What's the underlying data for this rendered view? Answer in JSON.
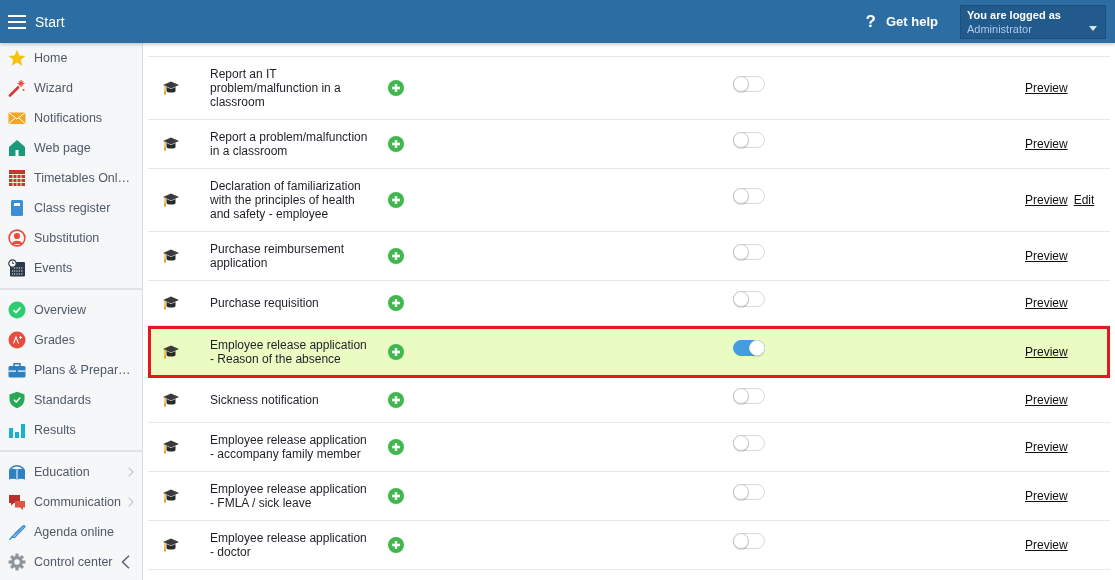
{
  "header": {
    "title": "Start",
    "help_icon": "?",
    "help_label": "Get help",
    "user": {
      "caption": "You are logged as",
      "name": "Administrator"
    }
  },
  "sidebar": {
    "groups": [
      {
        "items": [
          {
            "label": "Home",
            "submenu": false
          },
          {
            "label": "Wizard",
            "submenu": false
          },
          {
            "label": "Notifications",
            "submenu": false
          },
          {
            "label": "Web page",
            "submenu": false
          },
          {
            "label": "Timetables Onl…",
            "submenu": false
          },
          {
            "label": "Class register",
            "submenu": false
          },
          {
            "label": "Substitution",
            "submenu": false
          },
          {
            "label": "Events",
            "submenu": false
          }
        ]
      },
      {
        "items": [
          {
            "label": "Overview",
            "submenu": false
          },
          {
            "label": "Grades",
            "submenu": false
          },
          {
            "label": "Plans & Prepar…",
            "submenu": false
          },
          {
            "label": "Standards",
            "submenu": false
          },
          {
            "label": "Results",
            "submenu": false
          }
        ]
      },
      {
        "items": [
          {
            "label": "Education",
            "submenu": true
          },
          {
            "label": "Communication",
            "submenu": true
          },
          {
            "label": "Agenda online",
            "submenu": false
          },
          {
            "label": "Control center",
            "submenu": false
          }
        ]
      }
    ]
  },
  "table": {
    "rows": [
      {
        "title": "Report an IT problem/malfunction in a classroom",
        "selected": false,
        "enabled": false,
        "actions": [
          "Preview"
        ]
      },
      {
        "title": "Report a problem/malfunction in a classroom",
        "selected": false,
        "enabled": false,
        "actions": [
          "Preview"
        ]
      },
      {
        "title": "Declaration of familiarization with the principles of health and safety - employee",
        "selected": false,
        "enabled": false,
        "actions": [
          "Preview",
          "Edit"
        ]
      },
      {
        "title": "Purchase reimbursement application",
        "selected": false,
        "enabled": false,
        "actions": [
          "Preview"
        ]
      },
      {
        "title": "Purchase requisition",
        "selected": false,
        "enabled": false,
        "actions": [
          "Preview"
        ]
      },
      {
        "title": "Employee release application - Reason of the absence",
        "selected": true,
        "enabled": true,
        "actions": [
          "Preview"
        ]
      },
      {
        "title": "Sickness notification",
        "selected": false,
        "enabled": false,
        "actions": [
          "Preview"
        ]
      },
      {
        "title": "Employee release application - accompany family member",
        "selected": false,
        "enabled": false,
        "actions": [
          "Preview"
        ]
      },
      {
        "title": "Employee release application - FMLA / sick leave",
        "selected": false,
        "enabled": false,
        "actions": [
          "Preview"
        ]
      },
      {
        "title": "Employee release application - doctor",
        "selected": false,
        "enabled": false,
        "actions": [
          "Preview"
        ]
      }
    ]
  }
}
